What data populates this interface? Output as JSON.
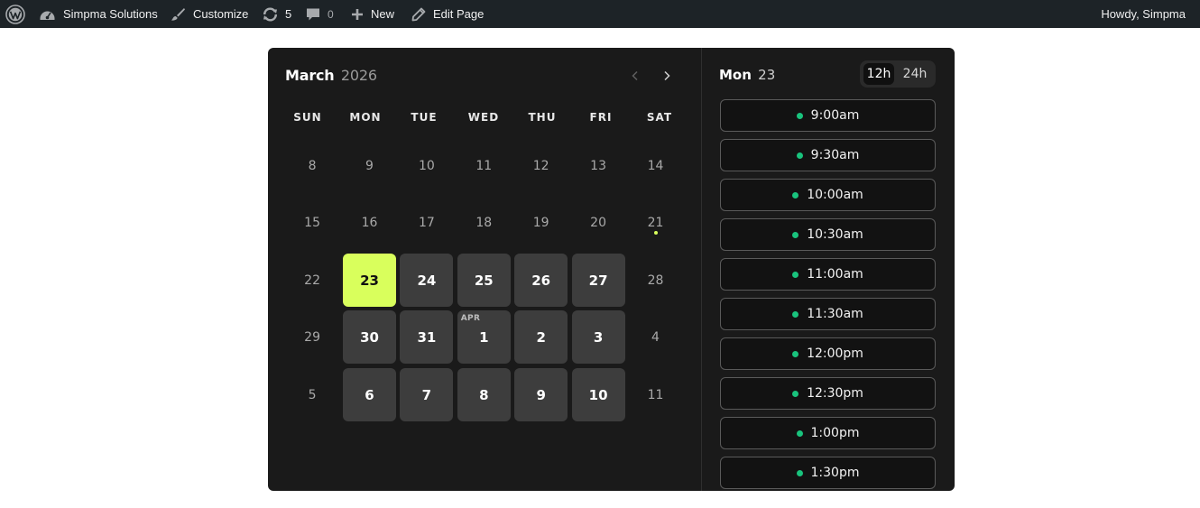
{
  "adminbar": {
    "site_name": "Simpma Solutions",
    "customize": "Customize",
    "updates_count": "5",
    "comments_count": "0",
    "new_label": "New",
    "edit_page": "Edit Page",
    "howdy": "Howdy, Simpma",
    "icons": [
      "wordpress-icon",
      "dashboard-icon",
      "brush-icon",
      "updates-icon",
      "comment-icon",
      "plus-icon",
      "pencil-icon"
    ]
  },
  "calendar": {
    "month": "March",
    "year": "2026",
    "weekdays": [
      "SUN",
      "MON",
      "TUE",
      "WED",
      "THU",
      "FRI",
      "SAT"
    ],
    "weeks": [
      [
        {
          "d": "8"
        },
        {
          "d": "9"
        },
        {
          "d": "10"
        },
        {
          "d": "11"
        },
        {
          "d": "12"
        },
        {
          "d": "13"
        },
        {
          "d": "14"
        }
      ],
      [
        {
          "d": "15"
        },
        {
          "d": "16"
        },
        {
          "d": "17"
        },
        {
          "d": "18"
        },
        {
          "d": "19"
        },
        {
          "d": "20"
        },
        {
          "d": "21",
          "today": true
        }
      ],
      [
        {
          "d": "22"
        },
        {
          "d": "23",
          "state": "selected"
        },
        {
          "d": "24",
          "state": "avail"
        },
        {
          "d": "25",
          "state": "avail"
        },
        {
          "d": "26",
          "state": "avail"
        },
        {
          "d": "27",
          "state": "avail"
        },
        {
          "d": "28"
        }
      ],
      [
        {
          "d": "29"
        },
        {
          "d": "30",
          "state": "avail"
        },
        {
          "d": "31",
          "state": "avail"
        },
        {
          "d": "1",
          "state": "avail",
          "month_tag": "APR"
        },
        {
          "d": "2",
          "state": "avail"
        },
        {
          "d": "3",
          "state": "avail"
        },
        {
          "d": "4"
        }
      ],
      [
        {
          "d": "5"
        },
        {
          "d": "6",
          "state": "avail"
        },
        {
          "d": "7",
          "state": "avail"
        },
        {
          "d": "8",
          "state": "avail"
        },
        {
          "d": "9",
          "state": "avail"
        },
        {
          "d": "10",
          "state": "avail"
        },
        {
          "d": "11"
        }
      ]
    ],
    "colors": {
      "selected": "#d9ff5c",
      "available": "#3d3d3d",
      "background": "#1a1a1a"
    }
  },
  "slots": {
    "day_name": "Mon",
    "day_num": "23",
    "format_12h": "12h",
    "format_24h": "24h",
    "active_format": "12h",
    "times": [
      "9:00am",
      "9:30am",
      "10:00am",
      "10:30am",
      "11:00am",
      "11:30am",
      "12:00pm",
      "12:30pm",
      "1:00pm",
      "1:30pm"
    ],
    "colors": {
      "available_dot": "#19c37d"
    }
  }
}
